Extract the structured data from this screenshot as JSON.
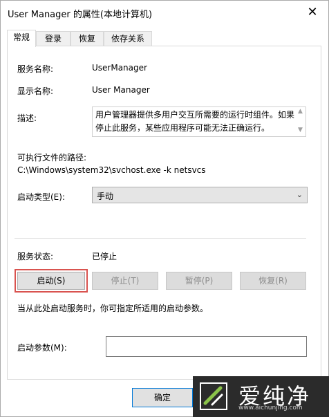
{
  "window": {
    "title": "User Manager 的属性(本地计算机)",
    "close_glyph": "✕"
  },
  "tabs": [
    {
      "label": "常规",
      "active": true
    },
    {
      "label": "登录",
      "active": false
    },
    {
      "label": "恢复",
      "active": false
    },
    {
      "label": "依存关系",
      "active": false
    }
  ],
  "general": {
    "service_name_label": "服务名称:",
    "service_name": "UserManager",
    "display_name_label": "显示名称:",
    "display_name": "User Manager",
    "description_label": "描述:",
    "description": "用户管理器提供多用户交互所需要的运行时组件。如果停止此服务，某些应用程序可能无法正确运行。",
    "path_label": "可执行文件的路径:",
    "path": "C:\\Windows\\system32\\svchost.exe -k netsvcs",
    "startup_type_label": "启动类型(E):",
    "startup_type": "手动",
    "status_label": "服务状态:",
    "status": "已停止",
    "start_button": "启动(S)",
    "stop_button": "停止(T)",
    "pause_button": "暂停(P)",
    "resume_button": "恢复(R)",
    "hint": "当从此处启动服务时，你可指定所适用的启动参数。",
    "params_label": "启动参数(M):",
    "params_value": ""
  },
  "footer": {
    "ok_button": "确定"
  },
  "watermark": {
    "text": "爱纯净",
    "url": "www.aichunjing.com"
  },
  "colors": {
    "highlight": "#d9534f",
    "ok_border": "#0078d7"
  }
}
